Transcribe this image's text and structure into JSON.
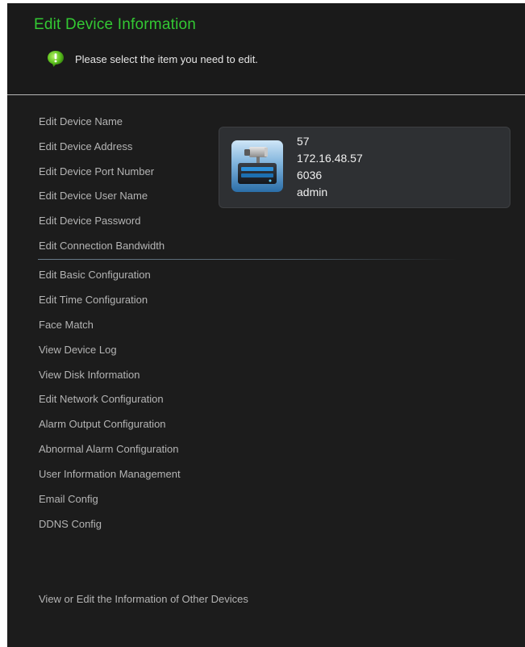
{
  "header": {
    "title": "Edit Device Information",
    "hint": "Please select the item you need to edit."
  },
  "menu": {
    "device_items": [
      "Edit Device Name",
      "Edit Device Address",
      "Edit Device Port Number",
      "Edit Device User Name",
      "Edit Device Password",
      "Edit Connection Bandwidth"
    ],
    "config_items": [
      "Edit Basic Configuration",
      "Edit Time Configuration",
      "Face Match",
      "View Device Log",
      "View Disk Information",
      "Edit Network Configuration",
      "Alarm Output Configuration",
      "Abnormal Alarm Configuration",
      "User Information Management",
      "Email Config",
      "DDNS Config"
    ]
  },
  "device": {
    "icon": "dvr-camera-icon",
    "name": "57",
    "address": "172.16.48.57",
    "port": "6036",
    "user": "admin"
  },
  "footer": {
    "other_devices": "View or Edit the Information of Other Devices"
  },
  "colors": {
    "title": "#33c833",
    "panel": "#1c1c1c",
    "menu_text": "#b4b4b4",
    "card": "#2e3033"
  }
}
